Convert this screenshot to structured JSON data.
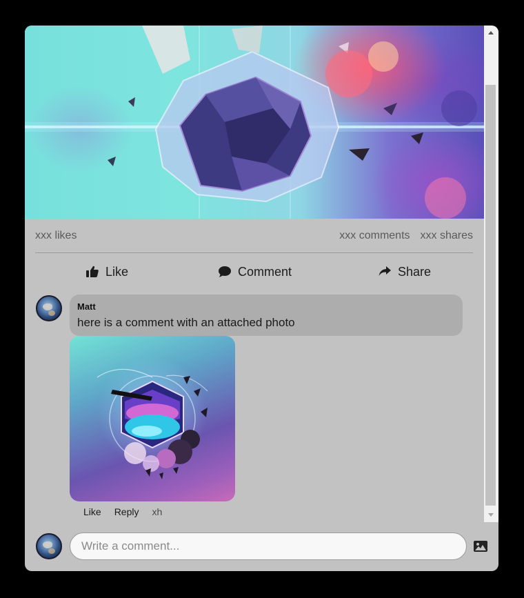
{
  "post": {
    "stats": {
      "likes": "xxx likes",
      "comments": "xxx comments",
      "shares": "xxx shares"
    },
    "actions": {
      "like": "Like",
      "comment": "Comment",
      "share": "Share"
    }
  },
  "comments": [
    {
      "author": "Matt",
      "text": "here is a comment with an attached photo",
      "actions": {
        "like": "Like",
        "reply": "Reply"
      },
      "time": "xh"
    }
  ],
  "composer": {
    "placeholder": "Write a comment..."
  },
  "icons": {
    "like": "thumbs-up-icon",
    "comment": "speech-bubble-icon",
    "share": "share-arrow-icon",
    "attach": "image-icon"
  },
  "colors": {
    "panel": "#c2c2c2",
    "bubble": "#adadad"
  }
}
